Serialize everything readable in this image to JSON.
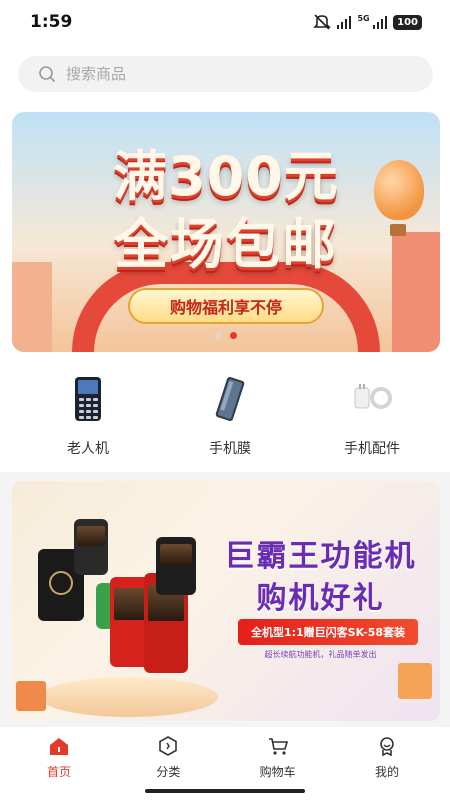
{
  "status_bar": {
    "time": "1:59",
    "network": "5G",
    "battery": "100"
  },
  "search": {
    "placeholder": "搜索商品"
  },
  "banner_main": {
    "headline_line1": "满300元",
    "headline_line2": "全场包邮",
    "ribbon_text": "购物福利享不停",
    "active_dot": 2,
    "dot_count": 2
  },
  "categories": [
    {
      "label": "老人机",
      "icon": "feature-phone-icon"
    },
    {
      "label": "手机膜",
      "icon": "screen-protector-icon"
    },
    {
      "label": "手机配件",
      "icon": "phone-accessory-icon"
    }
  ],
  "banner_promo": {
    "title_line1": "巨霸王功能机",
    "title_line2": "购机好礼",
    "pill_text": "全机型1:1赠巨闪客SK-58套装",
    "subtitle": "超长续航功能机，礼品随单发出"
  },
  "bottom_nav": [
    {
      "label": "首页",
      "icon": "home-icon",
      "active": true
    },
    {
      "label": "分类",
      "icon": "category-icon",
      "active": false
    },
    {
      "label": "购物车",
      "icon": "cart-icon",
      "active": false
    },
    {
      "label": "我的",
      "icon": "profile-icon",
      "active": false
    }
  ],
  "colors": {
    "accent": "#e23a2a",
    "promo_purple": "#6a2bb5"
  }
}
